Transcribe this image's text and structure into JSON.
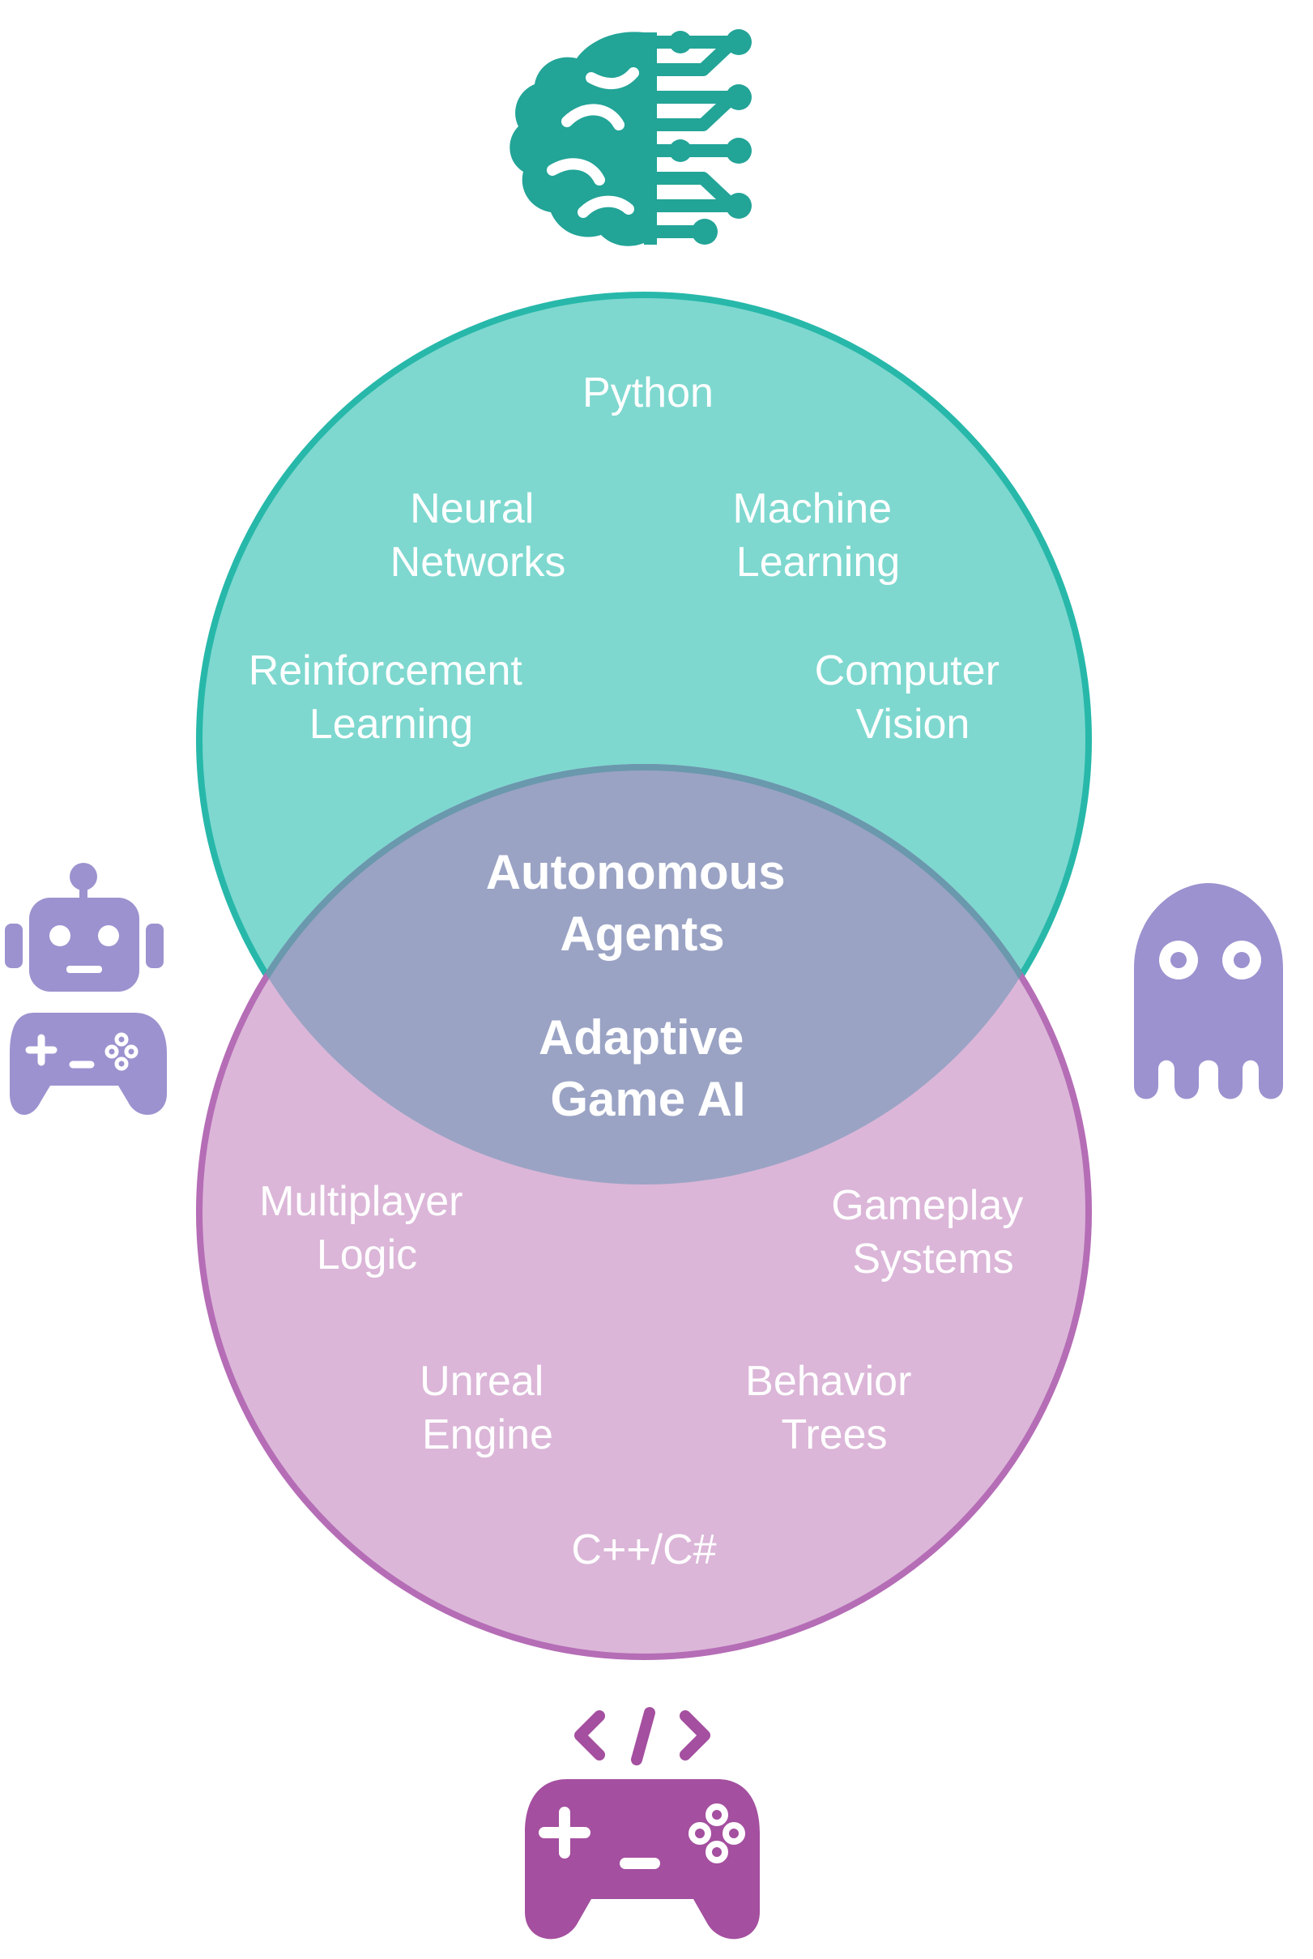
{
  "colors": {
    "ai_fill": "#7ed8cf",
    "ai_stroke": "#27b8aa",
    "game_fill": "#dbb6d8",
    "game_stroke": "#b56db6",
    "overlap_fill": "#9aa3c4",
    "overlap_stroke": "#6a98ad",
    "brain_icon": "#22a497",
    "robot_icon": "#9c92cf",
    "ghost_icon": "#9c92cf",
    "gamepad_icon": "#a44f9f"
  },
  "icons": {
    "top": "brain-circuit-icon",
    "left": "robot-gamepad-icon",
    "right": "ghost-icon",
    "bottom": "code-gamepad-icon"
  },
  "ai_circle": {
    "items": [
      {
        "lines": [
          "Python"
        ]
      },
      {
        "lines": [
          "Neural",
          "Networks"
        ]
      },
      {
        "lines": [
          "Machine",
          "Learning"
        ]
      },
      {
        "lines": [
          "Reinforcement",
          "Learning"
        ]
      },
      {
        "lines": [
          "Computer",
          "Vision"
        ]
      }
    ]
  },
  "overlap": {
    "items": [
      {
        "lines": [
          "Autonomous",
          "Agents"
        ]
      },
      {
        "lines": [
          "Adaptive",
          "Game AI"
        ]
      }
    ]
  },
  "game_circle": {
    "items": [
      {
        "lines": [
          "Multiplayer",
          "Logic"
        ]
      },
      {
        "lines": [
          "Gameplay",
          "Systems"
        ]
      },
      {
        "lines": [
          "Unreal",
          "Engine"
        ]
      },
      {
        "lines": [
          "Behavior",
          "Trees"
        ]
      },
      {
        "lines": [
          "C++/C#"
        ]
      }
    ]
  }
}
